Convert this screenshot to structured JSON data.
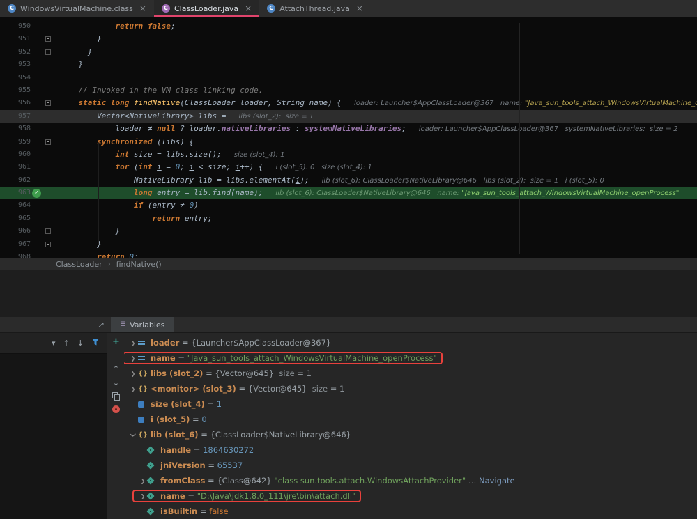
{
  "tabs": {
    "close_glyph": "×",
    "active_underline": "#e0446c",
    "items": [
      {
        "label": "WindowsVirtualMachine.class",
        "active": false,
        "icon_color": "#4f87c5",
        "icon_glyph": "C"
      },
      {
        "label": "ClassLoader.java",
        "active": true,
        "icon_color": "#a06bb5",
        "icon_glyph": "C"
      },
      {
        "label": "AttachThread.java",
        "active": false,
        "icon_color": "#4f87c5",
        "icon_glyph": "C"
      }
    ]
  },
  "editor": {
    "exec_line_no": "963",
    "caret_line_no": "957",
    "exec_badge_glyph": "✓",
    "gutter_fold_lines": [
      "951",
      "952",
      "956",
      "959",
      "966",
      "967"
    ],
    "lines": [
      {
        "no": "950",
        "segs": [
          [
            "k",
            "            return false"
          ],
          [
            "d",
            ";"
          ]
        ]
      },
      {
        "no": "951",
        "segs": [
          [
            "d",
            "        }"
          ]
        ]
      },
      {
        "no": "952",
        "segs": [
          [
            "d",
            "      }"
          ]
        ]
      },
      {
        "no": "953",
        "segs": [
          [
            "d",
            "    }"
          ]
        ]
      },
      {
        "no": "954",
        "segs": []
      },
      {
        "no": "955",
        "segs": [
          [
            "c",
            "    // Invoked in the VM class linking code."
          ]
        ]
      },
      {
        "no": "956",
        "segs": [
          [
            "k",
            "    static long "
          ],
          [
            "m",
            "findNative"
          ],
          [
            "d",
            "(ClassLoader loader, String name) {"
          ]
        ],
        "hint": [
          [
            "h",
            "loader: Launcher$AppClassLoader@367   name: "
          ],
          [
            "hs",
            "\"Java_sun_tools_attach_WindowsVirtualMachine_openProcess\""
          ]
        ]
      },
      {
        "no": "957",
        "segs": [
          [
            "d",
            "        Vector<NativeLibrary> libs ="
          ]
        ],
        "hint": [
          [
            "h",
            "libs (slot_2):  size = 1"
          ]
        ]
      },
      {
        "no": "958",
        "segs": [
          [
            "d",
            "            loader ≠ "
          ],
          [
            "k",
            "null"
          ],
          [
            "d",
            " ? loader."
          ],
          [
            "f",
            "nativeLibraries"
          ],
          [
            "d",
            " : "
          ],
          [
            "f",
            "systemNativeLibraries"
          ],
          [
            "d",
            ";"
          ]
        ],
        "hint": [
          [
            "h",
            "loader: Launcher$AppClassLoader@367   systemNativeLibraries:  size = 2"
          ]
        ]
      },
      {
        "no": "959",
        "segs": [
          [
            "k",
            "        synchronized "
          ],
          [
            "d",
            "(libs) {"
          ]
        ]
      },
      {
        "no": "960",
        "segs": [
          [
            "k",
            "            int "
          ],
          [
            "d",
            "size = libs.size();"
          ]
        ],
        "hint": [
          [
            "h",
            "size (slot_4): 1"
          ]
        ]
      },
      {
        "no": "961",
        "segs": [
          [
            "k",
            "            for "
          ],
          [
            "d",
            "("
          ],
          [
            "k",
            "int "
          ],
          [
            "u",
            "i"
          ],
          [
            "d",
            " = "
          ],
          [
            "n",
            "0"
          ],
          [
            "d",
            "; "
          ],
          [
            "u",
            "i"
          ],
          [
            "d",
            " < size; "
          ],
          [
            "u",
            "i"
          ],
          [
            "d",
            "++) {"
          ]
        ],
        "hint": [
          [
            "h",
            "i (slot_5): 0   size (slot_4): 1"
          ]
        ]
      },
      {
        "no": "962",
        "segs": [
          [
            "d",
            "                NativeLibrary lib = libs.elementAt("
          ],
          [
            "u",
            "i"
          ],
          [
            "d",
            ");"
          ]
        ],
        "hint": [
          [
            "h",
            "lib (slot_6): ClassLoader$NativeLibrary@646   libs (slot_2):  size = 1   i (slot_5): 0"
          ]
        ]
      },
      {
        "no": "963",
        "segs": [
          [
            "k",
            "                long "
          ],
          [
            "d",
            "entry = lib.find("
          ],
          [
            "u",
            "name"
          ],
          [
            "d",
            ");"
          ]
        ],
        "hint": [
          [
            "he",
            "lib (slot_6): ClassLoader$NativeLibrary@646   name: "
          ],
          [
            "hse",
            "\"Java_sun_tools_attach_WindowsVirtualMachine_openProcess\""
          ]
        ]
      },
      {
        "no": "964",
        "segs": [
          [
            "k",
            "                if "
          ],
          [
            "d",
            "(entry ≠ "
          ],
          [
            "n",
            "0"
          ],
          [
            "d",
            ")"
          ]
        ]
      },
      {
        "no": "965",
        "segs": [
          [
            "k",
            "                    return "
          ],
          [
            "d",
            "entry;"
          ]
        ]
      },
      {
        "no": "966",
        "segs": [
          [
            "d",
            "            }"
          ]
        ]
      },
      {
        "no": "967",
        "segs": [
          [
            "d",
            "        }"
          ]
        ]
      },
      {
        "no": "968",
        "segs": [
          [
            "k",
            "        return "
          ],
          [
            "n",
            "0"
          ],
          [
            "d",
            ";"
          ]
        ]
      }
    ]
  },
  "breadcrumb": {
    "items": [
      "ClassLoader",
      "findNative()"
    ],
    "sep": "›"
  },
  "debug": {
    "variables_tab_label": "Variables",
    "tab_icon_glyph": "☰",
    "icons": {
      "navigate": "↗",
      "dropdown": "▾",
      "up": "↑",
      "down": "↓",
      "add": "+",
      "remove": "−"
    }
  },
  "variables": {
    "chevron_glyph": "❯",
    "eq_label": " = ",
    "rows": [
      {
        "level": 0,
        "chev": "right",
        "icon": "param",
        "name": "loader",
        "value": [
          [
            "val",
            "{Launcher$AppClassLoader@367}"
          ]
        ]
      },
      {
        "level": 0,
        "chev": "right",
        "icon": "param",
        "name": "name",
        "annotated": true,
        "value": [
          [
            "str",
            "\"Java_sun_tools_attach_WindowsVirtualMachine_openProcess\""
          ]
        ]
      },
      {
        "level": 0,
        "chev": "right",
        "icon": "braces",
        "name": "libs (slot_2)",
        "value": [
          [
            "val",
            "{Vector@645}"
          ],
          [
            "meta",
            "  size = 1"
          ]
        ]
      },
      {
        "level": 0,
        "chev": "right",
        "icon": "braces",
        "name": "<monitor> (slot_3)",
        "value": [
          [
            "val",
            "{Vector@645}"
          ],
          [
            "meta",
            "  size = 1"
          ]
        ]
      },
      {
        "level": 0,
        "chev": "none",
        "icon": "prim",
        "name": "size (slot_4)",
        "value": [
          [
            "num",
            "1"
          ]
        ]
      },
      {
        "level": 0,
        "chev": "none",
        "icon": "prim",
        "name": "i (slot_5)",
        "value": [
          [
            "num",
            "0"
          ]
        ]
      },
      {
        "level": 0,
        "chev": "down",
        "icon": "braces",
        "name": "lib (slot_6)",
        "value": [
          [
            "val",
            "{ClassLoader$NativeLibrary@646}"
          ]
        ]
      },
      {
        "level": 1,
        "chev": "none",
        "icon": "field",
        "name": "handle",
        "value": [
          [
            "num",
            "1864630272"
          ]
        ]
      },
      {
        "level": 1,
        "chev": "none",
        "icon": "field",
        "name": "jniVersion",
        "value": [
          [
            "num",
            "65537"
          ]
        ]
      },
      {
        "level": 1,
        "chev": "right",
        "icon": "field",
        "name": "fromClass",
        "value": [
          [
            "val",
            "{Class@642} "
          ],
          [
            "str",
            "\"class sun.tools.attach.WindowsAttachProvider\""
          ],
          [
            "meta",
            " … "
          ],
          [
            "link",
            "Navigate"
          ]
        ]
      },
      {
        "level": 1,
        "chev": "right",
        "icon": "field",
        "name": "name",
        "annotated": true,
        "value": [
          [
            "str",
            "\"D:\\Java\\jdk1.8.0_111\\jre\\bin\\attach.dll\""
          ]
        ]
      },
      {
        "level": 1,
        "chev": "none",
        "icon": "field",
        "name": "isBuiltin",
        "value": [
          [
            "kw",
            "false"
          ]
        ]
      }
    ]
  }
}
